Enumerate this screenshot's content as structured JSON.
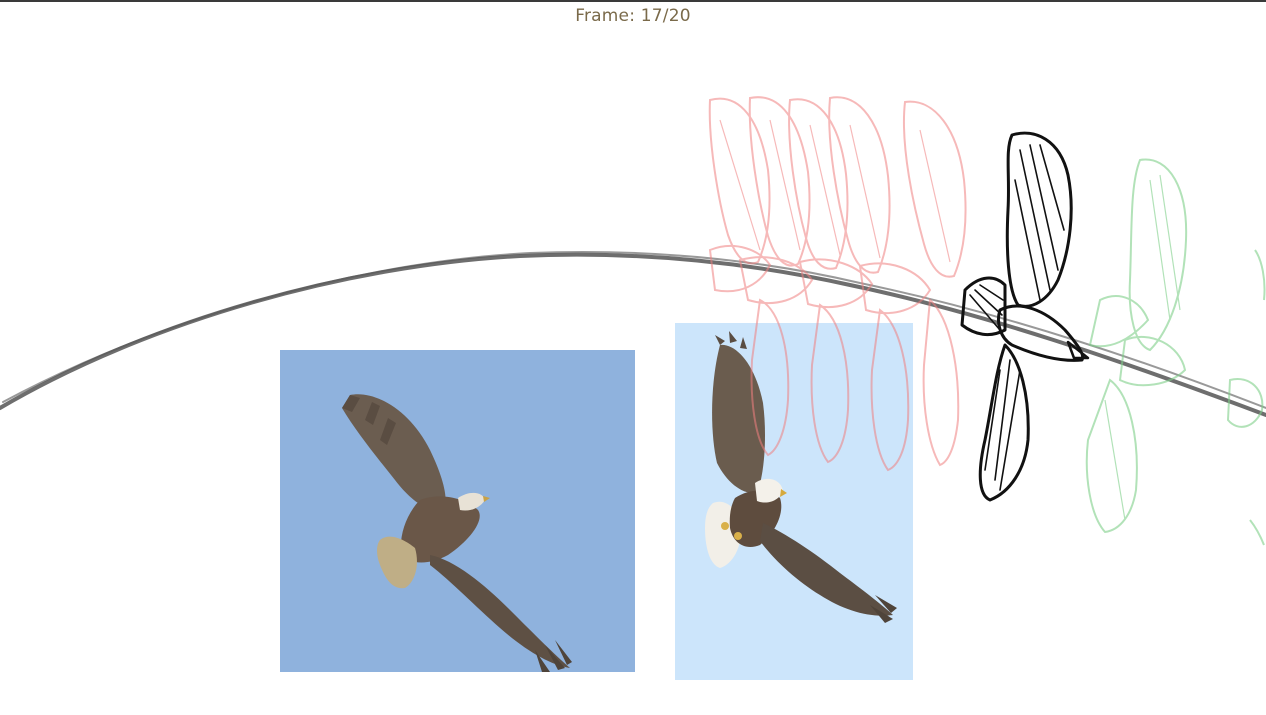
{
  "viewer": {
    "frame_label": "Frame: 17/20",
    "frame_current": 17,
    "frame_total": 20
  },
  "colors": {
    "frame_label_color": "#7a6a4a",
    "onion_previous": "#f08080",
    "onion_next": "#7fd08a",
    "current_stroke": "#111111",
    "path_stroke": "#555555",
    "photo_1_sky": "#8fb2dd",
    "photo_2_sky": "#cce5fb"
  },
  "reference_images": [
    {
      "name": "reference-photo-eagle-soaring",
      "icon": "eagle-photo"
    },
    {
      "name": "reference-photo-eagle-banking",
      "icon": "eagle-photo"
    }
  ]
}
